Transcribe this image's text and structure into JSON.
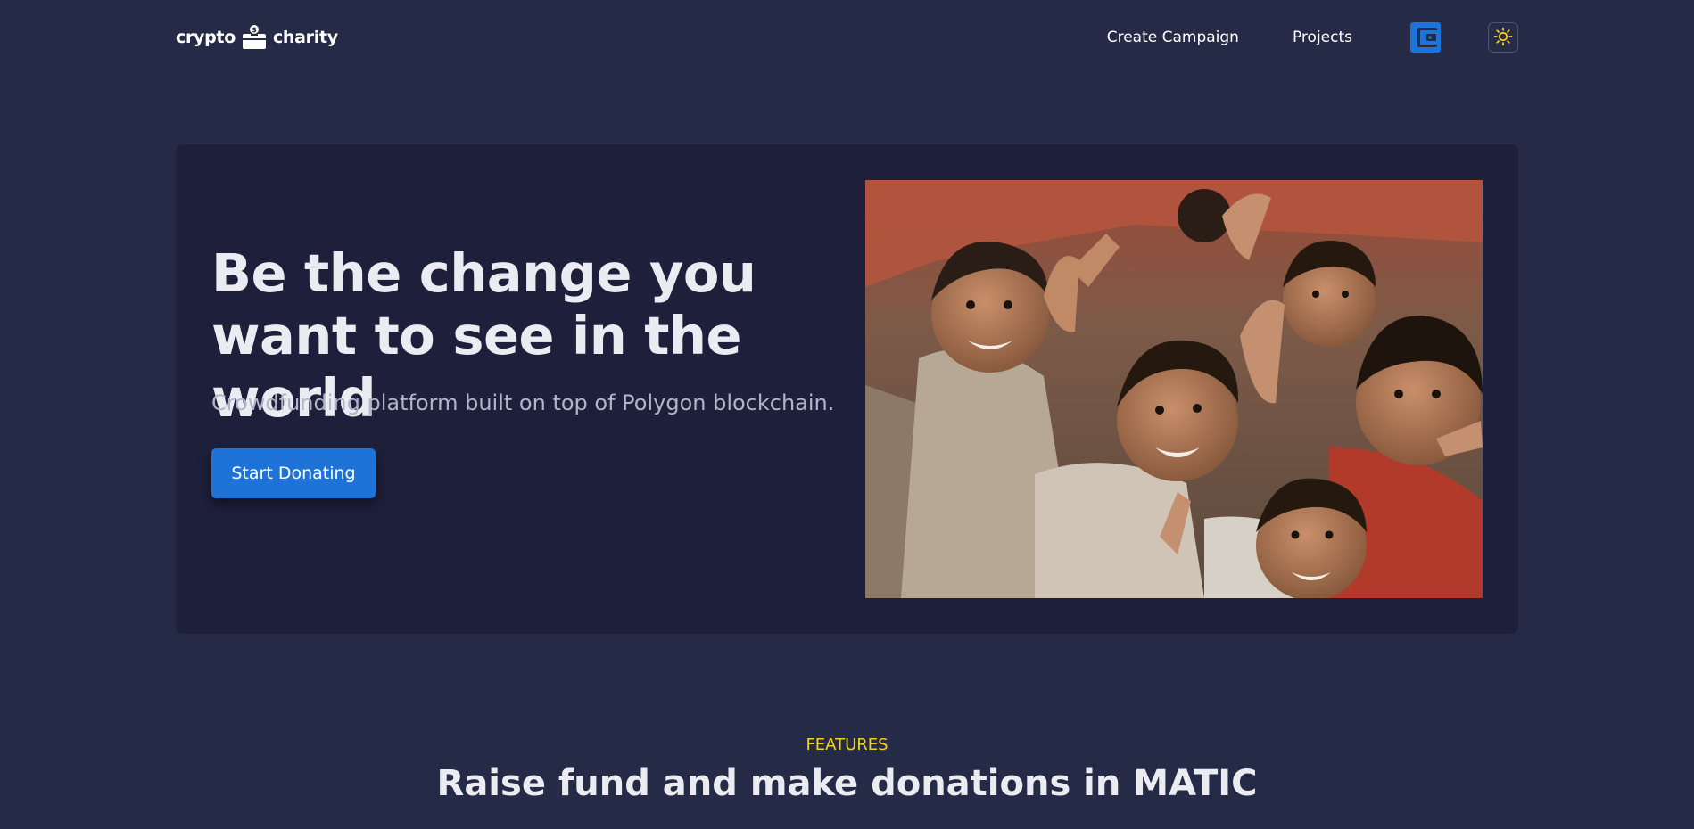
{
  "header": {
    "logo_left": "crypto",
    "logo_right": "charity",
    "nav": {
      "create_campaign": "Create Campaign",
      "projects": "Projects"
    },
    "icons": {
      "wallet": "wallet-icon",
      "theme": "sun-icon"
    }
  },
  "hero": {
    "title": "Be the change you want to see in the world",
    "subtitle": "Crowdfunding platform built on top of Polygon blockchain.",
    "cta_label": "Start Donating",
    "image": "children-photo"
  },
  "features": {
    "label": "FEATURES",
    "title": "Raise fund and make donations in MATIC"
  },
  "colors": {
    "background": "#252b46",
    "hero_card": "#1e1f3a",
    "primary": "#1d73d8",
    "accent": "#f2d21e"
  }
}
